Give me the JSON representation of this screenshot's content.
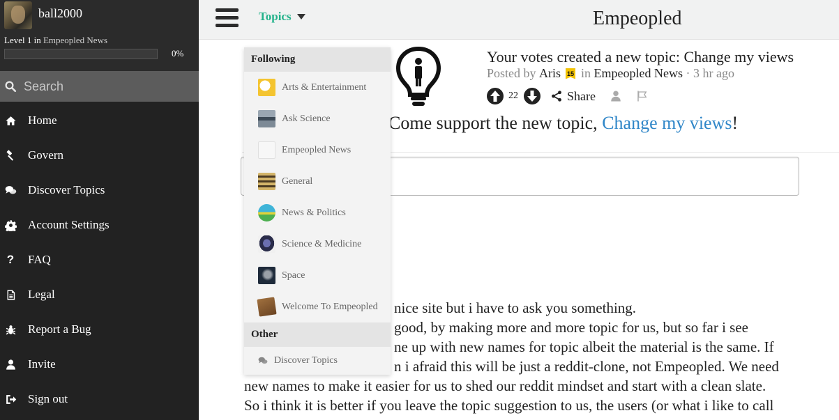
{
  "user": {
    "username": "ball2000",
    "level_prefix": "Level 1 in",
    "level_topic": "Empeopled News",
    "progress_percent_label": "0%",
    "progress_fraction": 0
  },
  "sidebar": {
    "search_placeholder": "Search",
    "items": [
      {
        "label": "Home",
        "icon": "home-icon"
      },
      {
        "label": "Govern",
        "icon": "gavel-icon"
      },
      {
        "label": "Discover Topics",
        "icon": "comments-icon"
      },
      {
        "label": "Account Settings",
        "icon": "gear-icon"
      },
      {
        "label": "FAQ",
        "icon": "question-icon"
      },
      {
        "label": "Legal",
        "icon": "document-icon"
      },
      {
        "label": "Report a Bug",
        "icon": "bug-icon"
      },
      {
        "label": "Invite",
        "icon": "user-icon"
      },
      {
        "label": "Sign out",
        "icon": "sign-out-icon"
      }
    ]
  },
  "topbar": {
    "topics_label": "Topics",
    "site_title": "Empeopled"
  },
  "post": {
    "title": "Your votes created a new topic: Change my views",
    "posted_by": "Posted by",
    "author": "Aris",
    "author_badge": "15",
    "in_word": "in",
    "topic": "Empeopled News",
    "age": "· 3 hr ago",
    "vote_count": "22",
    "share_label": "Share",
    "body_prefix": "Come support the new topic,",
    "body_link": "Change my views",
    "body_suffix": "!"
  },
  "comment": {
    "lines": [
      "nice site but i have to ask you something.",
      "good, by making more and more topic for us, but so far i see",
      "ne up with new names for topic albeit the material is the same. If",
      "n i afraid this will be just a reddit-clone, not Empeopled. We need",
      "new names to make it easier for us to shed our reddit mindset and start with a clean slate.",
      "So i think it is better if you leave the topic suggestion to us, the users (or what i like to call"
    ]
  },
  "dropdown": {
    "following_header": "Following",
    "following": [
      {
        "label": "Arts & Entertainment",
        "color": "#f4c430"
      },
      {
        "label": "Ask Science",
        "color": "#5a6a7a"
      },
      {
        "label": "Empeopled News",
        "color": "#f7f7f7"
      },
      {
        "label": "General",
        "color": "#8a6d3b"
      },
      {
        "label": "News & Politics",
        "color": "#3fb4d8"
      },
      {
        "label": "Science & Medicine",
        "color": "#3a3f6b"
      },
      {
        "label": "Space",
        "color": "#1e2a3a"
      },
      {
        "label": "Welcome To Empeopled",
        "color": "#7a5230"
      }
    ],
    "other_header": "Other",
    "discover_label": "Discover Topics"
  },
  "colors": {
    "accent_green": "#22b28a",
    "link_blue": "#2f86c8",
    "sidebar_bg": "#222222"
  }
}
